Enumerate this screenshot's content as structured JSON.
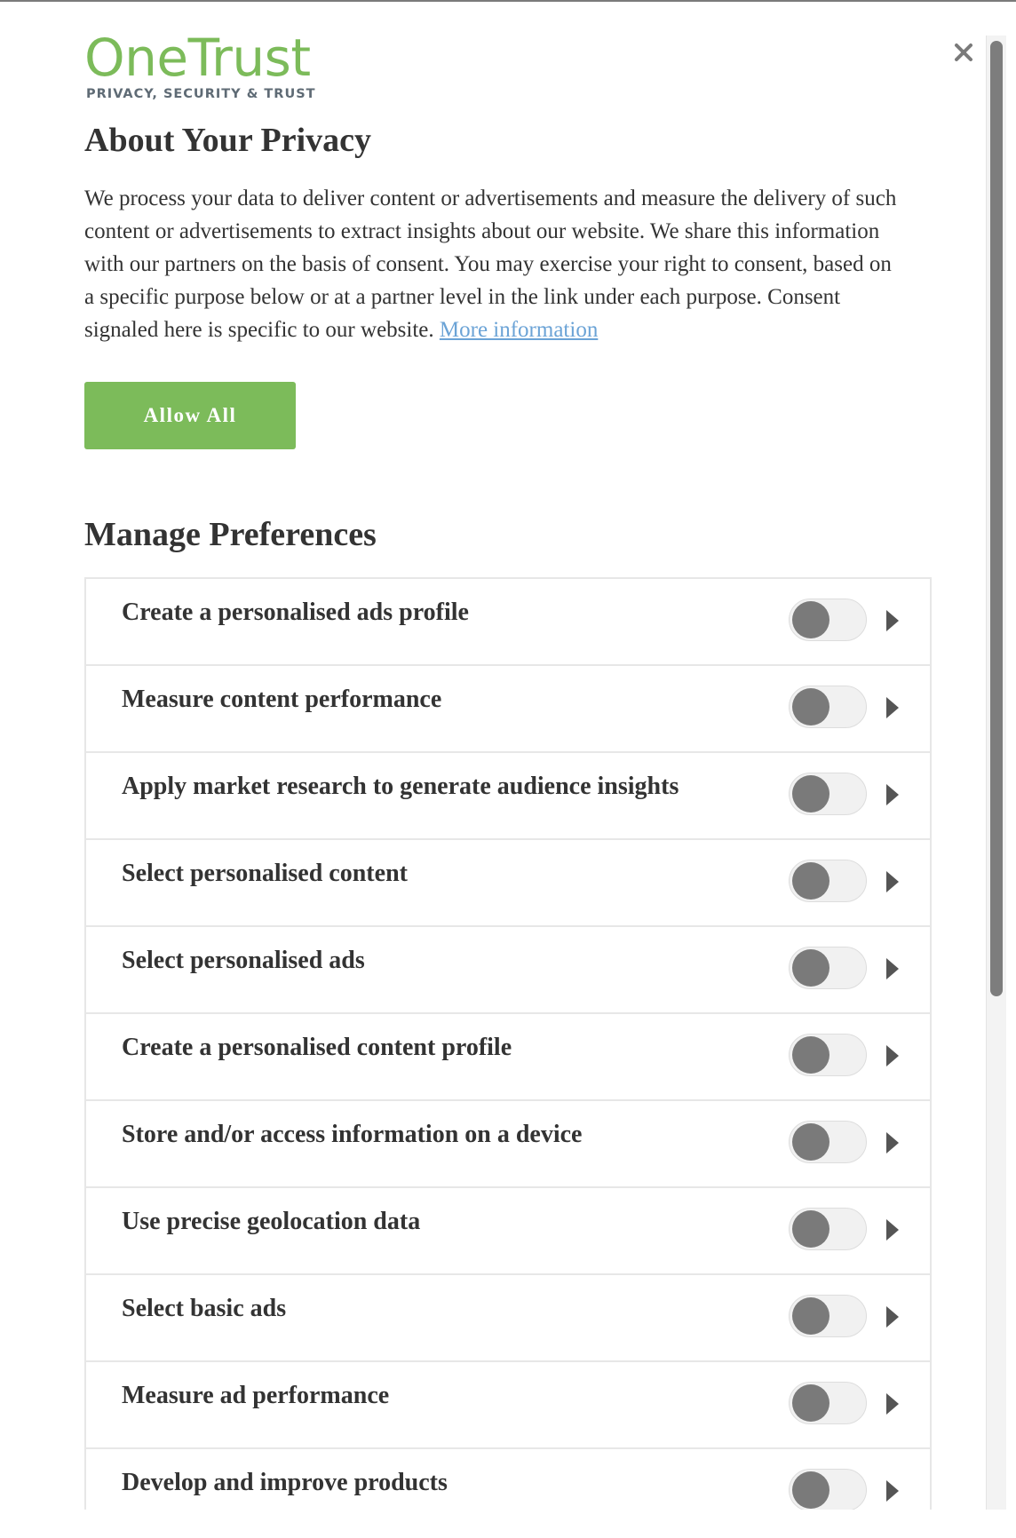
{
  "brand": {
    "name": "OneTrust",
    "tagline": "PRIVACY, SECURITY & TRUST",
    "color": "#7cbb5a"
  },
  "dialog": {
    "close_icon": "close-icon",
    "title": "About Your Privacy",
    "description": "We process your data to deliver content or advertisements and measure the delivery of such content or advertisements to extract insights about our website. We share this information with our partners on the basis of consent. You may exercise your right to consent, based on a specific purpose below or at a partner level in the link under each purpose. Consent signaled here is specific to our website.",
    "more_info_link": "More information",
    "allow_all_label": "Allow All"
  },
  "preferences": {
    "title": "Manage Preferences",
    "toggle_state": "off",
    "expand_icon": "caret-right-icon",
    "items": [
      {
        "label": "Create a personalised ads profile"
      },
      {
        "label": "Measure content performance"
      },
      {
        "label": "Apply market research to generate audience insights"
      },
      {
        "label": "Select personalised content"
      },
      {
        "label": "Select personalised ads"
      },
      {
        "label": "Create a personalised content profile"
      },
      {
        "label": "Store and/or access information on a device"
      },
      {
        "label": "Use precise geolocation data"
      },
      {
        "label": "Select basic ads"
      },
      {
        "label": "Measure ad performance"
      },
      {
        "label": "Develop and improve products"
      }
    ]
  },
  "colors": {
    "accent_green": "#7cbb5a",
    "link_blue": "#6ba3d6",
    "text_dark": "#333333",
    "toggle_off_knob": "#7a7a7a"
  }
}
